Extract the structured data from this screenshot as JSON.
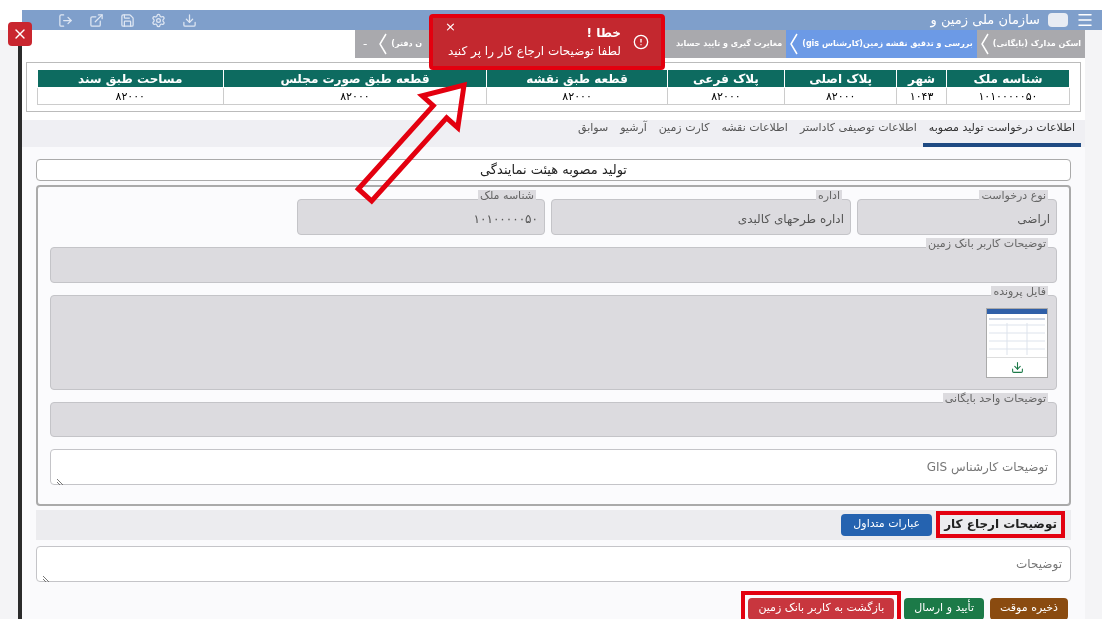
{
  "header": {
    "title": "سازمان ملی زمین و"
  },
  "steps": [
    {
      "label": "اسکن مدارک (بایگانی)",
      "selected": false
    },
    {
      "label": "بررسی و تدقیق نقشه زمین(کارشناس gis)",
      "selected": true
    },
    {
      "label": "مغایرت گیری و تایید حسابد",
      "selected": false
    },
    {
      "label": "ن دفتر)",
      "selected": false
    }
  ],
  "steps_toggle": "-",
  "toast": {
    "title": "خطا !",
    "message": "لطفا توضیحات ارجاع کار را پر کنید",
    "close": "×",
    "highlighted": true
  },
  "table": {
    "columns": [
      "شناسه ملک",
      "شهر",
      "پلاک اصلی",
      "پلاک فرعی",
      "قطعه طبق نقشه",
      "قطعه طبق صورت مجلس",
      "مساحت طبق سند"
    ],
    "rows": [
      [
        "۱۰۱۰۰۰۰۰۵۰",
        "۱۰۴۳",
        "۸۲۰۰۰",
        "۸۲۰۰۰",
        "۸۲۰۰۰",
        "۸۲۰۰۰",
        "۸۲۰۰۰"
      ]
    ]
  },
  "tabs": [
    {
      "label": "اطلاعات درخواست تولید مصوبه",
      "selected": true
    },
    {
      "label": "اطلاعات توصیفی کاداستر",
      "selected": false
    },
    {
      "label": "اطلاعات نقشه",
      "selected": false
    },
    {
      "label": "کارت زمین",
      "selected": false
    },
    {
      "label": "آرشیو",
      "selected": false
    },
    {
      "label": "سوابق",
      "selected": false
    }
  ],
  "section_title": "تولید مصوبه هیئت نمایندگی",
  "fields": [
    {
      "label": "نوع درخواست",
      "value": "اراضی"
    },
    {
      "label": "اداره",
      "value": "اداره طرحهای کالبدی"
    },
    {
      "label": "شناسه ملک",
      "value": "۱۰۱۰۰۰۰۰۵۰"
    }
  ],
  "bank_notes": {
    "label": "توضیحات کاربر بانک زمین"
  },
  "file": {
    "label": "فایل پرونده"
  },
  "archive_notes": {
    "label": "توضیحات واحد بایگانی"
  },
  "gis_notes": {
    "placeholder": "توضیحات کارشناس GIS"
  },
  "referral": {
    "label": "توضیحات ارجاع کار",
    "highlighted": true,
    "phrases_button": "عبارات متداول",
    "placeholder": "توضیحات"
  },
  "buttons": [
    {
      "label": "ذخیره موقت",
      "kind": "save",
      "highlighted": false
    },
    {
      "label": "تأیید و ارسال",
      "kind": "confirm",
      "highlighted": false
    },
    {
      "label": "بازگشت به کاربر بانک زمین",
      "kind": "return",
      "highlighted": true
    }
  ]
}
